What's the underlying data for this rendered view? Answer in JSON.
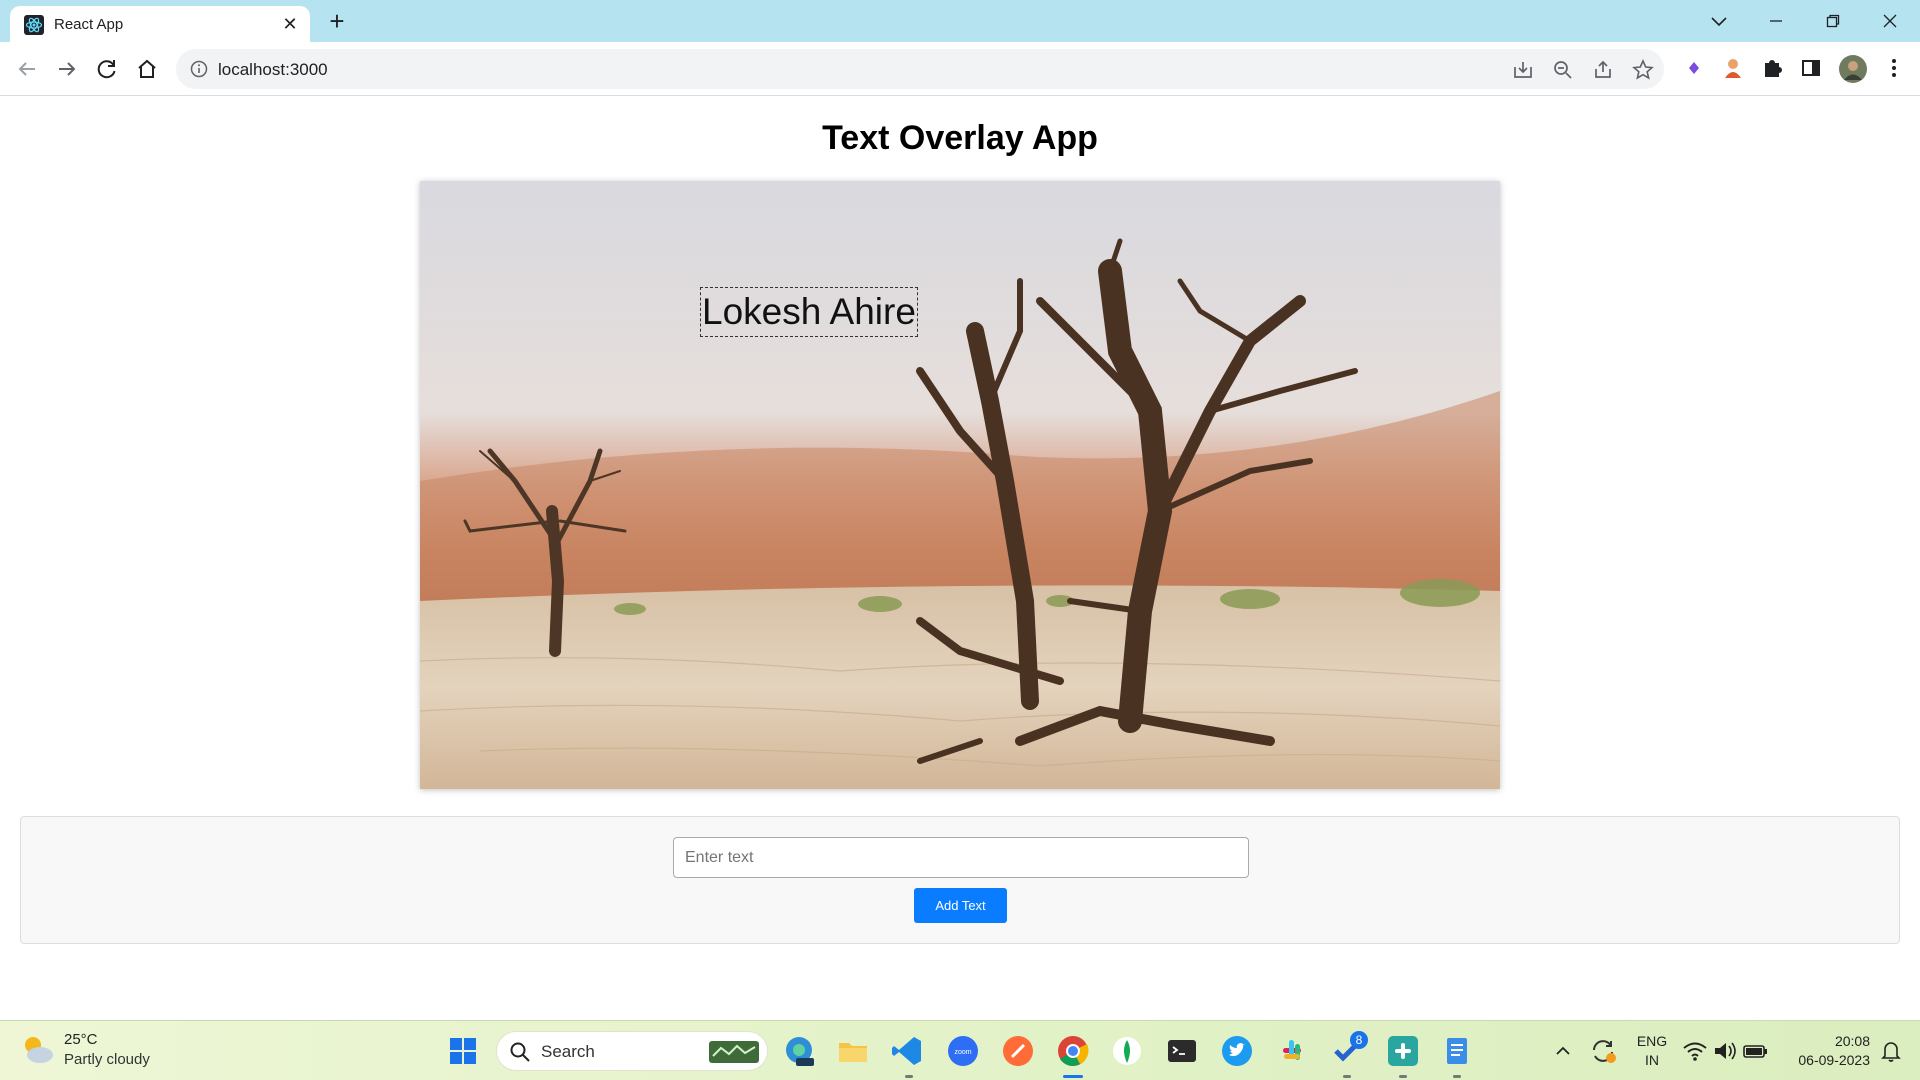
{
  "browser": {
    "tab_title": "React App",
    "tab_close": "✕",
    "new_tab": "+",
    "url": "localhost:3000"
  },
  "page": {
    "heading": "Text Overlay App",
    "overlay_text": "Lokesh Ahire",
    "input_placeholder": "Enter text",
    "input_value": "",
    "add_button_label": "Add Text"
  },
  "taskbar": {
    "weather_temp": "25°C",
    "weather_desc": "Partly cloudy",
    "search_label": "Search",
    "notification_badge": "8",
    "language": "ENG",
    "region": "IN",
    "time": "20:08",
    "date": "06-09-2023"
  },
  "colors": {
    "tab_strip": "#b6e3f0",
    "primary_button": "#0a7cff",
    "taskbar": "#e3f2c8"
  }
}
